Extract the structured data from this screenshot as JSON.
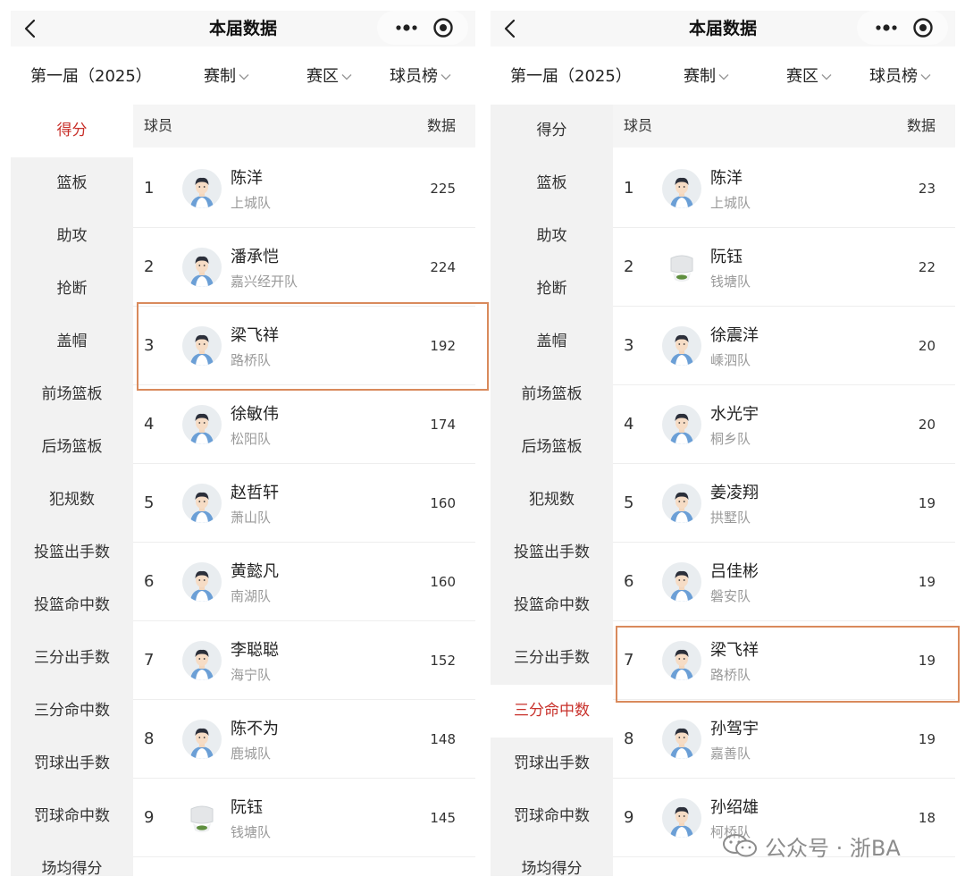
{
  "left": {
    "nav": {
      "title": "本届数据"
    },
    "filters": {
      "season": "第一届（2025）",
      "format": "赛制",
      "region": "赛区",
      "board": "球员榜"
    },
    "sidebar": [
      {
        "label": "得分",
        "active": true
      },
      {
        "label": "篮板",
        "active": false
      },
      {
        "label": "助攻",
        "active": false
      },
      {
        "label": "抢断",
        "active": false
      },
      {
        "label": "盖帽",
        "active": false
      },
      {
        "label": "前场篮板",
        "active": false
      },
      {
        "label": "后场篮板",
        "active": false
      },
      {
        "label": "犯规数",
        "active": false
      },
      {
        "label": "投篮出手数",
        "active": false
      },
      {
        "label": "投篮命中数",
        "active": false
      },
      {
        "label": "三分出手数",
        "active": false
      },
      {
        "label": "三分命中数",
        "active": false
      },
      {
        "label": "罚球出手数",
        "active": false
      },
      {
        "label": "罚球命中数",
        "active": false
      },
      {
        "label": "场均得分",
        "active": false
      }
    ],
    "list_header": {
      "player": "球员",
      "data": "数据"
    },
    "rows": [
      {
        "rank": "1",
        "name": "陈洋",
        "team": "上城队",
        "value": "225",
        "avatar": "player"
      },
      {
        "rank": "2",
        "name": "潘承恺",
        "team": "嘉兴经开队",
        "value": "224",
        "avatar": "player"
      },
      {
        "rank": "3",
        "name": "梁飞祥",
        "team": "路桥队",
        "value": "192",
        "avatar": "player"
      },
      {
        "rank": "4",
        "name": "徐敏伟",
        "team": "松阳队",
        "value": "174",
        "avatar": "player"
      },
      {
        "rank": "5",
        "name": "赵哲轩",
        "team": "萧山队",
        "value": "160",
        "avatar": "player"
      },
      {
        "rank": "6",
        "name": "黄懿凡",
        "team": "南湖队",
        "value": "160",
        "avatar": "player"
      },
      {
        "rank": "7",
        "name": "李聪聪",
        "team": "海宁队",
        "value": "152",
        "avatar": "player"
      },
      {
        "rank": "8",
        "name": "陈不为",
        "team": "鹿城队",
        "value": "148",
        "avatar": "player"
      },
      {
        "rank": "9",
        "name": "阮钰",
        "team": "钱塘队",
        "value": "145",
        "avatar": "jersey"
      }
    ]
  },
  "right": {
    "nav": {
      "title": "本届数据"
    },
    "filters": {
      "season": "第一届（2025）",
      "format": "赛制",
      "region": "赛区",
      "board": "球员榜"
    },
    "sidebar": [
      {
        "label": "得分",
        "active": false
      },
      {
        "label": "篮板",
        "active": false
      },
      {
        "label": "助攻",
        "active": false
      },
      {
        "label": "抢断",
        "active": false
      },
      {
        "label": "盖帽",
        "active": false
      },
      {
        "label": "前场篮板",
        "active": false
      },
      {
        "label": "后场篮板",
        "active": false
      },
      {
        "label": "犯规数",
        "active": false
      },
      {
        "label": "投篮出手数",
        "active": false
      },
      {
        "label": "投篮命中数",
        "active": false
      },
      {
        "label": "三分出手数",
        "active": false
      },
      {
        "label": "三分命中数",
        "active": true
      },
      {
        "label": "罚球出手数",
        "active": false
      },
      {
        "label": "罚球命中数",
        "active": false
      },
      {
        "label": "场均得分",
        "active": false
      }
    ],
    "list_header": {
      "player": "球员",
      "data": "数据"
    },
    "rows": [
      {
        "rank": "1",
        "name": "陈洋",
        "team": "上城队",
        "value": "23",
        "avatar": "player"
      },
      {
        "rank": "2",
        "name": "阮钰",
        "team": "钱塘队",
        "value": "22",
        "avatar": "jersey"
      },
      {
        "rank": "3",
        "name": "徐震洋",
        "team": "嵊泗队",
        "value": "20",
        "avatar": "player"
      },
      {
        "rank": "4",
        "name": "水光宇",
        "team": "桐乡队",
        "value": "20",
        "avatar": "player"
      },
      {
        "rank": "5",
        "name": "姜凌翔",
        "team": "拱墅队",
        "value": "19",
        "avatar": "player"
      },
      {
        "rank": "6",
        "name": "吕佳彬",
        "team": "磐安队",
        "value": "19",
        "avatar": "player"
      },
      {
        "rank": "7",
        "name": "梁飞祥",
        "team": "路桥队",
        "value": "19",
        "avatar": "player"
      },
      {
        "rank": "8",
        "name": "孙驾宇",
        "team": "嘉善队",
        "value": "19",
        "avatar": "player"
      },
      {
        "rank": "9",
        "name": "孙绍雄",
        "team": "柯桥队",
        "value": "18",
        "avatar": "player"
      }
    ]
  },
  "watermark": {
    "text": "公众号 · 浙BA"
  },
  "colors": {
    "active": "#c8312b",
    "highlight": "#d98a5c",
    "sidebar_bg": "#f2f2f2",
    "team_text": "#9a9a9a"
  }
}
